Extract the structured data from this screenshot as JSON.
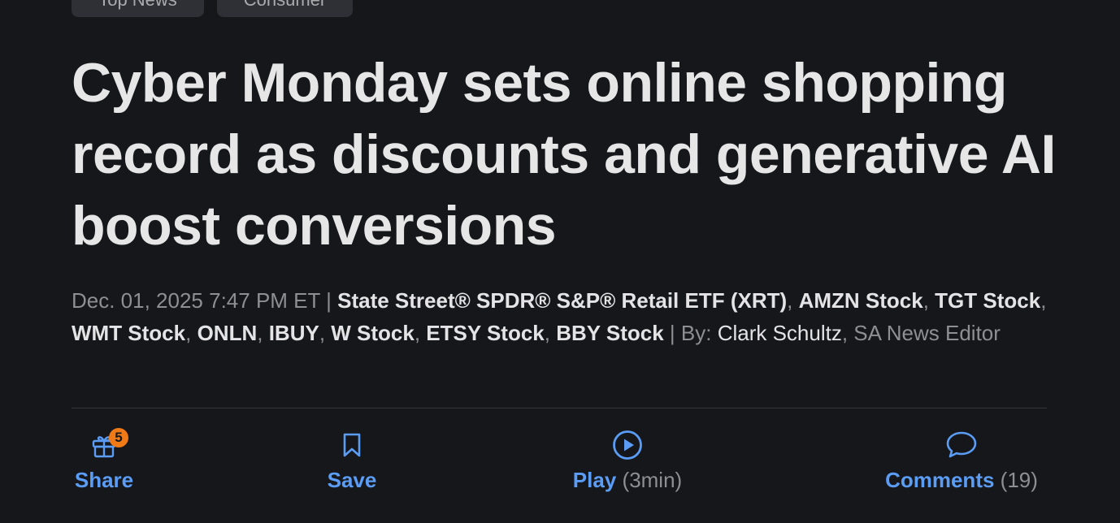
{
  "tags": [
    "Top News",
    "Consumer"
  ],
  "headline": "Cyber Monday sets online shopping record as discounts and generative AI boost conversions",
  "byline": {
    "date": "Dec. 01, 2025 7:47 PM ET",
    "tickers": [
      "State Street® SPDR® S&P® Retail ETF (XRT)",
      "AMZN Stock",
      "TGT Stock",
      "WMT Stock",
      "ONLN",
      "IBUY",
      "W Stock",
      "ETSY Stock",
      "BBY Stock"
    ],
    "by_label": "By:",
    "author": "Clark Schultz",
    "author_role": "SA News Editor"
  },
  "actions": {
    "share": {
      "label": "Share",
      "badge": "5",
      "icon": "gift-icon"
    },
    "save": {
      "label": "Save",
      "icon": "bookmark-icon"
    },
    "play": {
      "label": "Play",
      "duration": "(3min)",
      "icon": "play-circle-icon"
    },
    "comments": {
      "label": "Comments",
      "count": "(19)",
      "icon": "speech-bubble-icon"
    }
  },
  "colors": {
    "background": "#15171b",
    "accent": "#5b9cf5",
    "badge": "#f07b16",
    "muted": "#8d8f93"
  }
}
